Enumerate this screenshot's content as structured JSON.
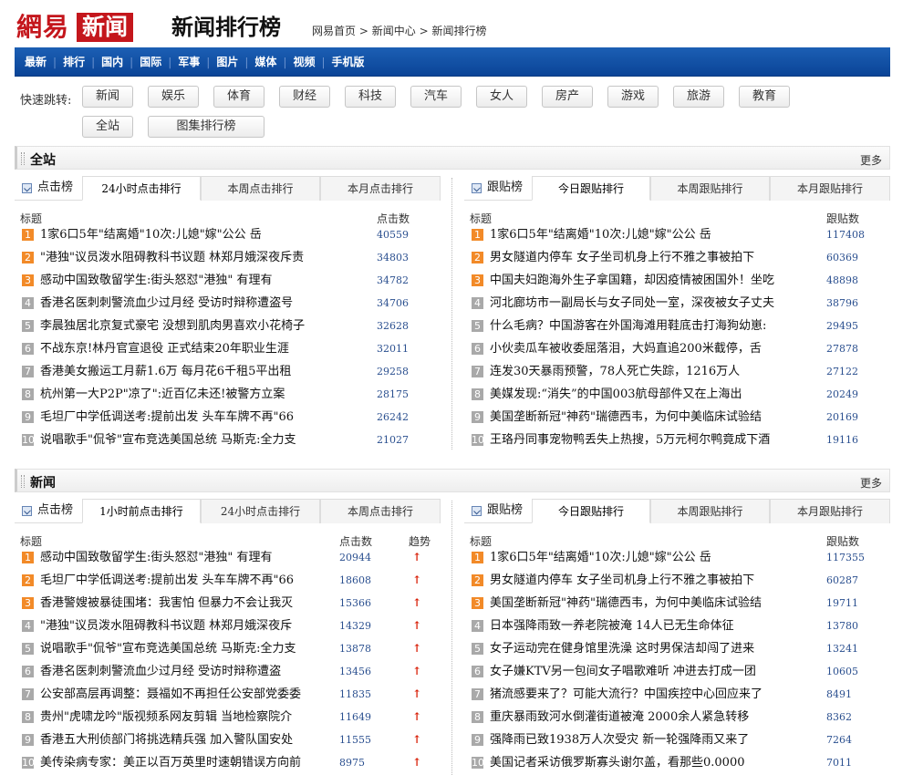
{
  "header": {
    "logo_text": "網易",
    "logo_box": "新闻",
    "title": "新闻排行榜",
    "breadcrumb": [
      "网易首页",
      "新闻中心",
      "新闻排行榜"
    ]
  },
  "nav": [
    "最新",
    "排行",
    "国内",
    "国际",
    "军事",
    "图片",
    "媒体",
    "视频",
    "手机版"
  ],
  "quickjump": {
    "label": "快速跳转:",
    "buttons": [
      "新闻",
      "娱乐",
      "体育",
      "财经",
      "科技",
      "汽车",
      "女人",
      "房产",
      "游戏",
      "旅游",
      "教育",
      "全站",
      "图集排行榜"
    ]
  },
  "sections": [
    {
      "title": "全站",
      "more": "更多",
      "left": {
        "lead": "点击榜",
        "tabs": [
          "24小时点击排行",
          "本周点击排行",
          "本月点击排行"
        ],
        "col_title": "标题",
        "col_count": "点击数",
        "rows": [
          {
            "rank": "1",
            "title": "1家6口5年\"结离婚\"10次:儿媳\"嫁\"公公 岳",
            "count": "40559"
          },
          {
            "rank": "2",
            "title": "\"港独\"议员泼水阻碍教科书议题 林郑月娥深夜斥责",
            "count": "34803"
          },
          {
            "rank": "3",
            "title": "感动中国致敬留学生:街头怒怼\"港独\" 有理有",
            "count": "34782"
          },
          {
            "rank": "4",
            "title": "香港名医刺刺警流血少过月经 受访时辩称遭盗号",
            "count": "34706"
          },
          {
            "rank": "5",
            "title": "李晨独居北京复式豪宅 没想到肌肉男喜欢小花椅子",
            "count": "32628"
          },
          {
            "rank": "6",
            "title": "不战东京!林丹官宣退役 正式结束20年职业生涯",
            "count": "32011"
          },
          {
            "rank": "7",
            "title": "香港美女搬运工月薪1.6万 每月花6千租5平出租",
            "count": "29258"
          },
          {
            "rank": "8",
            "title": "杭州第一大P2P\"凉了\":近百亿未还!被警方立案",
            "count": "28175"
          },
          {
            "rank": "9",
            "title": "毛坦厂中学低调送考:提前出发 头车车牌不再\"66",
            "count": "26242"
          },
          {
            "rank": "10",
            "title": "说唱歌手\"侃爷\"宣布竞选美国总统 马斯克:全力支",
            "count": "21027"
          }
        ]
      },
      "right": {
        "lead": "跟贴榜",
        "tabs": [
          "今日跟贴排行",
          "本周跟贴排行",
          "本月跟贴排行"
        ],
        "col_title": "标题",
        "col_count": "跟贴数",
        "rows": [
          {
            "rank": "1",
            "title": "1家6口5年\"结离婚\"10次:儿媳\"嫁\"公公 岳",
            "count": "117408"
          },
          {
            "rank": "2",
            "title": "男女隧道内停车 女子坐司机身上行不雅之事被拍下",
            "count": "60369"
          },
          {
            "rank": "3",
            "title": "中国夫妇跑海外生子拿国籍，却因疫情被困国外！坐吃",
            "count": "48898"
          },
          {
            "rank": "4",
            "title": "河北廊坊市一副局长与女子同处一室，深夜被女子丈夫",
            "count": "38796"
          },
          {
            "rank": "5",
            "title": "什么毛病？中国游客在外国海滩用鞋底击打海狗幼崽:",
            "count": "29495"
          },
          {
            "rank": "6",
            "title": "小伙卖瓜车被收委屈落泪，大妈直追200米截停，舌",
            "count": "27878"
          },
          {
            "rank": "7",
            "title": "连发30天暴雨预警，78人死亡失踪，1216万人",
            "count": "27122"
          },
          {
            "rank": "8",
            "title": "美媒发现:“消失”的中国003航母部件又在上海出",
            "count": "20249"
          },
          {
            "rank": "9",
            "title": "美国垄断新冠\"神药\"瑞德西韦，为何中美临床试验结",
            "count": "20169"
          },
          {
            "rank": "10",
            "title": "王珞丹同事宠物鸭丢失上热搜，5万元柯尔鸭竟成下酒",
            "count": "19116"
          }
        ]
      }
    },
    {
      "title": "新闻",
      "more": "更多",
      "left": {
        "lead": "点击榜",
        "tabs": [
          "1小时前点击排行",
          "24小时点击排行",
          "本周点击排行"
        ],
        "col_title": "标题",
        "col_count": "点击数",
        "col_trend": "趋势",
        "rows": [
          {
            "rank": "1",
            "title": "感动中国致敬留学生:街头怒怼\"港独\" 有理有",
            "count": "20944",
            "trend": "🠙"
          },
          {
            "rank": "2",
            "title": "毛坦厂中学低调送考:提前出发 头车车牌不再\"66",
            "count": "18608",
            "trend": "🠙"
          },
          {
            "rank": "3",
            "title": "香港警嫂被暴徒围堵：我害怕 但暴力不会让我灭",
            "count": "15366",
            "trend": "🠙"
          },
          {
            "rank": "4",
            "title": "\"港独\"议员泼水阻碍教科书议题 林郑月娥深夜斥",
            "count": "14329",
            "trend": "🠙"
          },
          {
            "rank": "5",
            "title": "说唱歌手\"侃爷\"宣布竞选美国总统 马斯克:全力支",
            "count": "13878",
            "trend": "🠙"
          },
          {
            "rank": "6",
            "title": "香港名医刺刺警流血少过月经 受访时辩称遭盗",
            "count": "13456",
            "trend": "🠙"
          },
          {
            "rank": "7",
            "title": "公安部高层再调整：聂福如不再担任公安部党委委",
            "count": "11835",
            "trend": "🠙"
          },
          {
            "rank": "8",
            "title": "贵州\"虎啸龙吟\"版视频系网友剪辑 当地检察院介",
            "count": "11649",
            "trend": "🠙"
          },
          {
            "rank": "9",
            "title": "香港五大刑侦部门将挑选精兵强 加入警队国安处",
            "count": "11555",
            "trend": "🠙"
          },
          {
            "rank": "10",
            "title": "美传染病专家：美正以百万英里时速朝错误方向前",
            "count": "8975",
            "trend": "🠙"
          }
        ]
      },
      "right": {
        "lead": "跟贴榜",
        "tabs": [
          "今日跟贴排行",
          "本周跟贴排行",
          "本月跟贴排行"
        ],
        "col_title": "标题",
        "col_count": "跟贴数",
        "rows": [
          {
            "rank": "1",
            "title": "1家6口5年\"结离婚\"10次:儿媳\"嫁\"公公 岳",
            "count": "117355"
          },
          {
            "rank": "2",
            "title": "男女隧道内停车 女子坐司机身上行不雅之事被拍下",
            "count": "60287"
          },
          {
            "rank": "3",
            "title": "美国垄断新冠\"神药\"瑞德西韦，为何中美临床试验结",
            "count": "19711"
          },
          {
            "rank": "4",
            "title": "日本强降雨致一养老院被淹 14人已无生命体征",
            "count": "13780"
          },
          {
            "rank": "5",
            "title": "女子运动完在健身馆里洗澡 这时男保洁却闯了进来",
            "count": "13241"
          },
          {
            "rank": "6",
            "title": "女子嫌KTV另一包间女子唱歌难听 冲进去打成一团",
            "count": "10605"
          },
          {
            "rank": "7",
            "title": "猪流感要来了？可能大流行？中国疾控中心回应来了",
            "count": "8491"
          },
          {
            "rank": "8",
            "title": "重庆暴雨致河水倒灌街道被淹 2000余人紧急转移",
            "count": "8362"
          },
          {
            "rank": "9",
            "title": "强降雨已致1938万人次受灾 新一轮强降雨又来了",
            "count": "7264"
          },
          {
            "rank": "10",
            "title": "美国记者采访俄罗斯寡头谢尔盖，看那些0.0000",
            "count": "7011"
          }
        ]
      }
    }
  ],
  "colors": {
    "nav_bg": "#0a4497",
    "logo_red": "#c4161c",
    "rank_hot": "#f28a28",
    "rank_cold": "#a9a9a9",
    "count_blue": "#2a4f8f",
    "trend_red": "#d81e06"
  }
}
